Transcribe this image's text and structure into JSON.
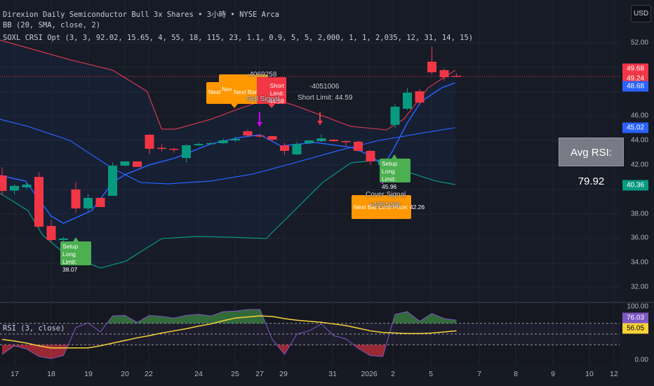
{
  "header": {
    "symbol_line": "Direxion Daily Semiconductor Bull 3x Shares • 3小時 • NYSE Arca",
    "bb_line": "BB (20, SMA, close, 2)",
    "strategy_line": "SOXL CRSI Opt (3, 3, 92.02, 15.65, 4, 55, 18, 115, 23, 1.1, 0.9, 5, 5, 2,000, 1, 1, 2,035, 12, 31, 14, 15)",
    "currency_button": "USD"
  },
  "colors": {
    "up": "#089981",
    "down": "#f23645",
    "upper_band": "#d0394f",
    "basis": "#2962ff",
    "lower_band": "#089981",
    "rsi": "#7e57c2",
    "rsi_ma": "#f7d23a",
    "orange": "#ff9800",
    "green_label": "#4caf50"
  },
  "price_axis": {
    "ticks": [
      "52.00",
      "46.00",
      "44.00",
      "42.00",
      "38.00",
      "36.00",
      "34.00",
      "32.00"
    ],
    "tags": [
      {
        "text": "49.68",
        "color": "#f23645",
        "price": 49.68
      },
      {
        "text": "49.24",
        "color": "#f23645",
        "price": 49.24
      },
      {
        "text": "48.68",
        "color": "#2962ff",
        "price": 48.68
      },
      {
        "text": "45.02",
        "color": "#2962ff",
        "price": 45.02
      },
      {
        "text": "40.36",
        "color": "#089981",
        "price": 40.36
      }
    ]
  },
  "rsi_axis": {
    "ticks": [
      "100.00",
      "0.00"
    ],
    "tags": [
      {
        "text": "76.03",
        "color": "#7e57c2",
        "value": 76.03
      },
      {
        "text": "56.05",
        "color": "#f7d23a",
        "value": 56.05
      }
    ]
  },
  "rsi_pane": {
    "title": "RSI (3, close)",
    "levels": [
      70,
      50,
      30
    ]
  },
  "time_axis": [
    "17",
    "18",
    "19",
    "20",
    "22",
    "24",
    "25",
    "27",
    "29",
    "31",
    "2026",
    "2",
    "5",
    "7",
    "8",
    "9",
    "10",
    "12"
  ],
  "avg_rsi": "Avg RSI: 79.92",
  "signals": {
    "next_1": "Next",
    "next_2": "Next",
    "next_bar": "Next Bar",
    "sell_id": "-4069258",
    "short_box": "Short Limit: 44.59",
    "sell_signal": "Sell Signal",
    "short_id_2": "-4051006",
    "short_limit_2": "Short Limit: 44.59",
    "setup_long_1": "Setup Long",
    "setup_long_1_limit": "Limit: 45.96",
    "cover_signal": "Cover Signal",
    "cover_id": "+4051006",
    "cover_limit": "Next Bar Limit Price: 42.26",
    "setup_long_2": "Setup Long",
    "setup_long_2_limit": "Limit: 38.07"
  },
  "chart_data": {
    "type": "candlestick",
    "price_range": [
      30.4,
      53.2
    ],
    "last_close_line": 49.24,
    "candles": [
      [
        41.14,
        41.8,
        39.5,
        39.87
      ],
      [
        39.9,
        40.4,
        39.6,
        40.28
      ],
      [
        40.16,
        40.6,
        40.0,
        40.39
      ],
      [
        41.02,
        41.4,
        36.9,
        36.94
      ],
      [
        37.0,
        37.5,
        35.6,
        35.85
      ],
      [
        35.85,
        36.1,
        35.6,
        35.97
      ],
      [
        39.99,
        40.6,
        38.1,
        38.44
      ],
      [
        38.44,
        39.6,
        38.2,
        39.3
      ],
      [
        39.3,
        39.3,
        38.55,
        38.55
      ],
      [
        39.47,
        42.2,
        39.47,
        41.94
      ],
      [
        41.94,
        42.29,
        41.9,
        42.29
      ],
      [
        42.29,
        42.29,
        41.83,
        41.83
      ],
      [
        44.47,
        44.5,
        42.9,
        43.32
      ],
      [
        43.4,
        43.7,
        43.1,
        43.32
      ],
      [
        43.32,
        43.4,
        43.0,
        43.26
      ],
      [
        42.57,
        43.7,
        42.2,
        43.61
      ],
      [
        43.61,
        43.85,
        43.5,
        43.72
      ],
      [
        43.72,
        43.9,
        43.7,
        43.78
      ],
      [
        43.78,
        44.2,
        43.7,
        44.01
      ],
      [
        44.01,
        44.3,
        43.9,
        44.13
      ],
      [
        44.76,
        44.9,
        44.3,
        44.41
      ],
      [
        44.41,
        44.5,
        44.2,
        44.36
      ],
      [
        44.36,
        44.4,
        43.9,
        44.07
      ],
      [
        43.6,
        43.8,
        42.8,
        43.15
      ],
      [
        42.86,
        43.9,
        42.8,
        43.72
      ],
      [
        43.78,
        44.0,
        43.7,
        44.01
      ],
      [
        43.95,
        44.5,
        43.9,
        44.18
      ],
      [
        44.07,
        44.1,
        43.9,
        43.95
      ],
      [
        43.95,
        44.0,
        43.5,
        43.9
      ],
      [
        43.9,
        44.0,
        43.1,
        43.15
      ],
      [
        43.15,
        43.2,
        42.0,
        42.29
      ],
      [
        42.0,
        42.5,
        41.9,
        42.4
      ],
      [
        45.28,
        47.0,
        45.0,
        46.77
      ],
      [
        46.6,
        48.3,
        46.5,
        47.92
      ],
      [
        48.03,
        48.2,
        46.9,
        47.11
      ],
      [
        50.45,
        51.7,
        49.4,
        49.59
      ],
      [
        49.76,
        49.9,
        48.9,
        49.18
      ],
      [
        49.3,
        49.5,
        49.2,
        49.24
      ]
    ],
    "upper_band": [
      [
        -0.2,
        52.23
      ],
      [
        5.5,
        50.62
      ],
      [
        9,
        49.76
      ],
      [
        11.8,
        48.03
      ],
      [
        13,
        44.93
      ],
      [
        14.1,
        44.93
      ],
      [
        17,
        45.74
      ],
      [
        19.3,
        46.6
      ],
      [
        21.8,
        47.46
      ],
      [
        23.8,
        46.89
      ],
      [
        26.1,
        46.02
      ],
      [
        28.4,
        45.16
      ],
      [
        31.3,
        44.87
      ],
      [
        32.7,
        45.74
      ],
      [
        34.7,
        48.32
      ],
      [
        36.9,
        49.76
      ]
    ],
    "middle_band": [
      [
        -0.2,
        45.74
      ],
      [
        2.1,
        45.16
      ],
      [
        5.5,
        44.01
      ],
      [
        9,
        41.71
      ],
      [
        11.3,
        40.56
      ],
      [
        13.5,
        40.45
      ],
      [
        17,
        40.68
      ],
      [
        20.4,
        41.25
      ],
      [
        23.8,
        42.17
      ],
      [
        27.3,
        43.15
      ],
      [
        30.7,
        44.01
      ],
      [
        34.1,
        44.59
      ],
      [
        36.9,
        45.05
      ]
    ],
    "lower_band": [
      [
        -0.2,
        39.7
      ],
      [
        2.1,
        38.26
      ],
      [
        3.3,
        36.25
      ],
      [
        5,
        34.82
      ],
      [
        8,
        33.55
      ],
      [
        10.1,
        34.13
      ],
      [
        13,
        35.97
      ],
      [
        15.8,
        36.14
      ],
      [
        18.7,
        36.08
      ],
      [
        21.5,
        35.97
      ],
      [
        23.8,
        38.26
      ],
      [
        26.1,
        40.56
      ],
      [
        28.4,
        42.17
      ],
      [
        30.7,
        42.4
      ],
      [
        33,
        41.43
      ],
      [
        35.3,
        40.68
      ],
      [
        36.9,
        40.39
      ]
    ],
    "fast_line": [
      [
        -0.2,
        41.14
      ],
      [
        1.9,
        40.68
      ],
      [
        4,
        37.8
      ],
      [
        5,
        37.23
      ],
      [
        7.3,
        38.26
      ],
      [
        9,
        40.56
      ],
      [
        10.1,
        41.25
      ],
      [
        12,
        42
      ],
      [
        14.1,
        42.57
      ],
      [
        17,
        43.72
      ],
      [
        19.3,
        44.24
      ],
      [
        21,
        44.47
      ],
      [
        22.7,
        43.55
      ],
      [
        25.5,
        43.84
      ],
      [
        28.4,
        43.44
      ],
      [
        30.1,
        42.75
      ],
      [
        31,
        41.89
      ],
      [
        31.8,
        43.15
      ],
      [
        33,
        45.45
      ],
      [
        34.1,
        47.17
      ],
      [
        35.8,
        48.32
      ],
      [
        36.9,
        48.72
      ]
    ],
    "rsi": [
      12,
      28,
      22,
      8,
      4,
      10,
      62,
      71,
      54,
      84,
      85,
      72,
      85,
      83,
      80,
      85,
      87,
      84,
      92,
      93,
      96,
      96,
      40,
      12,
      50,
      56,
      69,
      47,
      41,
      23,
      9.6,
      8,
      87,
      92,
      74,
      88.6,
      79,
      76.03
    ],
    "rsi_ma": [
      40,
      37,
      33,
      28,
      24,
      24,
      24,
      24,
      28,
      33,
      38,
      43,
      47,
      52,
      56,
      60,
      65,
      69,
      75,
      80,
      82,
      84,
      83,
      79,
      76,
      74,
      72,
      69,
      66,
      61,
      56,
      53,
      52,
      51,
      51,
      52,
      54,
      56.05
    ]
  }
}
